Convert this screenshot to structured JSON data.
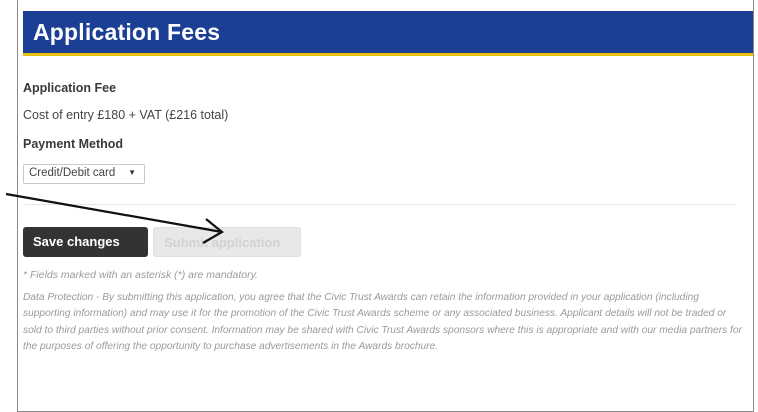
{
  "header": {
    "title": "Application Fees"
  },
  "form": {
    "fee_label": "Application Fee",
    "fee_text": "Cost of entry £180 + VAT (£216 total)",
    "payment_label": "Payment Method",
    "payment_selected": "Credit/Debit card"
  },
  "actions": {
    "save_label": "Save changes",
    "submit_label": "Submit application"
  },
  "footer": {
    "mandatory_note": "* Fields marked with an asterisk (*) are mandatory.",
    "data_protection": "Data Protection - By submitting this application, you agree that the Civic Trust Awards can retain the information provided in your application (including supporting information) and may use it for the promotion of the Civic Trust Awards scheme or any associated business. Applicant details will not be traded or sold to third parties without prior consent. Information may be shared with Civic Trust Awards sponsors where this is appropriate and with our media partners for the purposes of offering the opportunity to purchase advertisements in the Awards brochure."
  },
  "colors": {
    "header_bg": "#1b3f94",
    "header_border": "#e8c10d",
    "save_bg": "#333333"
  },
  "icons": {
    "dropdown": "caret-down-icon",
    "annotation": "arrow-icon"
  }
}
